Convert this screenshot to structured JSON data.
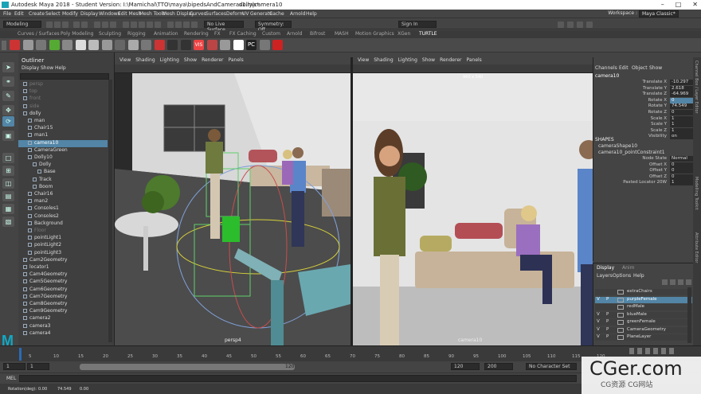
{
  "title": {
    "text": "Autodesk Maya 2018 - Student Version: I:\\Mamichal\\TTO\\maya\\bipedsAndCameras1.ma*",
    "selection": "dolly|camera10"
  },
  "menus": [
    "File",
    "Edit",
    "Create",
    "Select",
    "Modify",
    "Display",
    "Windows",
    "Edit Mesh",
    "Mesh Tools",
    "Mesh Display",
    "Curves",
    "Surfaces",
    "Deform",
    "UV",
    "Generate",
    "Cache",
    "Arnold",
    "Help"
  ],
  "workspace": {
    "label": "Workspace :",
    "value": "Maya Classic*"
  },
  "status_line": {
    "mode": "Modeling",
    "live_surface": "No Live Surface",
    "symmetry": "Symmetry: Off",
    "sign_in": "Sign In"
  },
  "shelf_tabs": [
    "Curves / Surfaces",
    "Poly Modeling",
    "Sculpting",
    "Rigging",
    "Animation",
    "Rendering",
    "FX",
    "FX Caching",
    "Custom",
    "Arnold",
    "Bifrost",
    "MASH",
    "Motion Graphics",
    "XGen",
    "TURTLE"
  ],
  "shelf_tab_selected": "TURTLE",
  "shelf_icons": [
    {
      "name": "teapot-icon",
      "color": "#c33"
    },
    {
      "name": "ring-icon",
      "color": "#999"
    },
    {
      "name": "sphere-icon",
      "color": "#777"
    },
    {
      "name": "green-ball-icon",
      "color": "#5a3"
    },
    {
      "name": "shaded-sphere-icon",
      "color": "#888"
    },
    {
      "name": "lamp-icon",
      "color": "#ddd"
    },
    {
      "name": "dome-icon",
      "color": "#bbb"
    },
    {
      "name": "cube-icon",
      "color": "#999"
    },
    {
      "name": "checker-icon",
      "color": "#666"
    },
    {
      "name": "torus-icon",
      "color": "#aaa"
    },
    {
      "name": "grey-ball-icon",
      "color": "#777"
    },
    {
      "name": "red-ball-icon",
      "color": "#c33"
    },
    {
      "name": "render-settings-icon",
      "color": "#333"
    },
    {
      "name": "render-icon",
      "color": "#333"
    },
    {
      "name": "vis-icon",
      "color": "#e44"
    },
    {
      "name": "reset-icon",
      "color": "#b44"
    },
    {
      "name": "box-icon",
      "color": "#999"
    },
    {
      "name": "page-icon",
      "color": "#fff"
    },
    {
      "name": "pc-icon",
      "color": "#222"
    },
    {
      "name": "wire-icon",
      "color": "#777"
    },
    {
      "name": "red-x-icon",
      "color": "#c22"
    }
  ],
  "shelf_icon_labels": {
    "vis": "VIS",
    "pc": "PC"
  },
  "outliner": {
    "title": "Outliner",
    "menu": [
      "Display",
      "Show",
      "Help"
    ],
    "items": [
      {
        "label": "persp",
        "indent": 0,
        "faded": true
      },
      {
        "label": "top",
        "indent": 0,
        "faded": true
      },
      {
        "label": "front",
        "indent": 0,
        "faded": true
      },
      {
        "label": "side",
        "indent": 0,
        "faded": true
      },
      {
        "label": "dolly",
        "indent": 0
      },
      {
        "label": "man",
        "indent": 1
      },
      {
        "label": "Chair15",
        "indent": 1
      },
      {
        "label": "man1",
        "indent": 1
      },
      {
        "label": "camera10",
        "indent": 1,
        "selected": true
      },
      {
        "label": "CameraGreen",
        "indent": 1
      },
      {
        "label": "Dolly10",
        "indent": 1
      },
      {
        "label": "Dolly",
        "indent": 2
      },
      {
        "label": "Base",
        "indent": 3
      },
      {
        "label": "Track",
        "indent": 2
      },
      {
        "label": "Boom",
        "indent": 2
      },
      {
        "label": "Chair16",
        "indent": 1
      },
      {
        "label": "man2",
        "indent": 1
      },
      {
        "label": "Consoles1",
        "indent": 1
      },
      {
        "label": "Consoles2",
        "indent": 1
      },
      {
        "label": "Background",
        "indent": 1
      },
      {
        "label": "Floor",
        "indent": 1,
        "faded": true
      },
      {
        "label": "pointLight1",
        "indent": 1
      },
      {
        "label": "pointLight2",
        "indent": 1
      },
      {
        "label": "pointLight3",
        "indent": 1
      },
      {
        "label": "Cam2Geometry",
        "indent": 0
      },
      {
        "label": "locator1",
        "indent": 0
      },
      {
        "label": "Cam4Geometry",
        "indent": 0
      },
      {
        "label": "Cam5Geometry",
        "indent": 0
      },
      {
        "label": "Cam6Geometry",
        "indent": 0
      },
      {
        "label": "Cam7Geometry",
        "indent": 0
      },
      {
        "label": "Cam8Geometry",
        "indent": 0
      },
      {
        "label": "Cam9Geometry",
        "indent": 0
      },
      {
        "label": "camera2",
        "indent": 0
      },
      {
        "label": "camera3",
        "indent": 0
      },
      {
        "label": "camera4",
        "indent": 0
      }
    ]
  },
  "viewport_menu": [
    "View",
    "Shading",
    "Lighting",
    "Show",
    "Renderer",
    "Panels"
  ],
  "viewport_left": {
    "camera_label": "persp4"
  },
  "viewport_right": {
    "camera_label": "camera10",
    "resolution": "960 x 540"
  },
  "channel_box": {
    "menu": [
      "Channels",
      "Edit",
      "Object",
      "Show"
    ],
    "object": "camera10",
    "attributes": [
      {
        "name": "Translate X",
        "value": "-10.297",
        "highlighted": false
      },
      {
        "name": "Translate Y",
        "value": "2.618",
        "highlighted": false
      },
      {
        "name": "Translate Z",
        "value": "-64.969",
        "highlighted": false
      },
      {
        "name": "Rotate X",
        "value": "0",
        "highlighted": true
      },
      {
        "name": "Rotate Y",
        "value": "74.549",
        "highlighted": false
      },
      {
        "name": "Rotate Z",
        "value": "0",
        "highlighted": false
      },
      {
        "name": "Scale X",
        "value": "1",
        "highlighted": false
      },
      {
        "name": "Scale Y",
        "value": "1",
        "highlighted": false
      },
      {
        "name": "Scale Z",
        "value": "1",
        "highlighted": false
      },
      {
        "name": "Visibility",
        "value": "on",
        "highlighted": false
      }
    ],
    "shapes_header": "SHAPES",
    "shape_names": [
      "cameraShape10",
      "camera10_pointConstraint1"
    ],
    "constraint_attrs": [
      {
        "name": "Node State",
        "value": "Normal"
      },
      {
        "name": "Offset X",
        "value": "0"
      },
      {
        "name": "Offset Y",
        "value": "0"
      },
      {
        "name": "Offset Z",
        "value": "0"
      },
      {
        "name": "Pasted Locator 20W",
        "value": "1"
      }
    ]
  },
  "side_tabs": [
    "Channel Box / Layer Editor",
    "Modelling Toolkit",
    "Attribute Editor"
  ],
  "layer_editor": {
    "tabs": [
      "Display",
      "Anim"
    ],
    "menu": [
      "Layers",
      "Options",
      "Help"
    ],
    "layers": [
      {
        "v": "",
        "p": "",
        "name": "extraChairs",
        "selected": false
      },
      {
        "v": "V",
        "p": "P",
        "name": "purpleFemale",
        "selected": true
      },
      {
        "v": "",
        "p": "",
        "name": "redMale",
        "selected": false
      },
      {
        "v": "V",
        "p": "P",
        "name": "blueMale",
        "selected": false
      },
      {
        "v": "V",
        "p": "P",
        "name": "greenFemale",
        "selected": false
      },
      {
        "v": "V",
        "p": "P",
        "name": "CameraGeometry",
        "selected": false
      },
      {
        "v": "V",
        "p": "P",
        "name": "PlaneLayer",
        "selected": false
      }
    ]
  },
  "time_slider": {
    "ticks": [
      "5",
      "10",
      "15",
      "20",
      "25",
      "30",
      "35",
      "40",
      "45",
      "50",
      "55",
      "60",
      "65",
      "70",
      "75",
      "80",
      "85",
      "90",
      "95",
      "100",
      "105",
      "110",
      "115",
      "120"
    ],
    "current_frame": "1"
  },
  "range": {
    "start": "1",
    "inner_start": "1",
    "inner_end": "120",
    "end": "120",
    "end2": "200",
    "char_set": "No Character Set",
    "anim_layer": "No Anim Layer",
    "fps": "24 fps"
  },
  "command_line": {
    "label": "MEL"
  },
  "help_line": {
    "fields": [
      "Rotation(deg):",
      "0.00",
      "74.549",
      "0.00"
    ]
  },
  "watermark": {
    "main": "CGer.com",
    "sub": "CG资源 CG网站"
  },
  "logo": "M"
}
